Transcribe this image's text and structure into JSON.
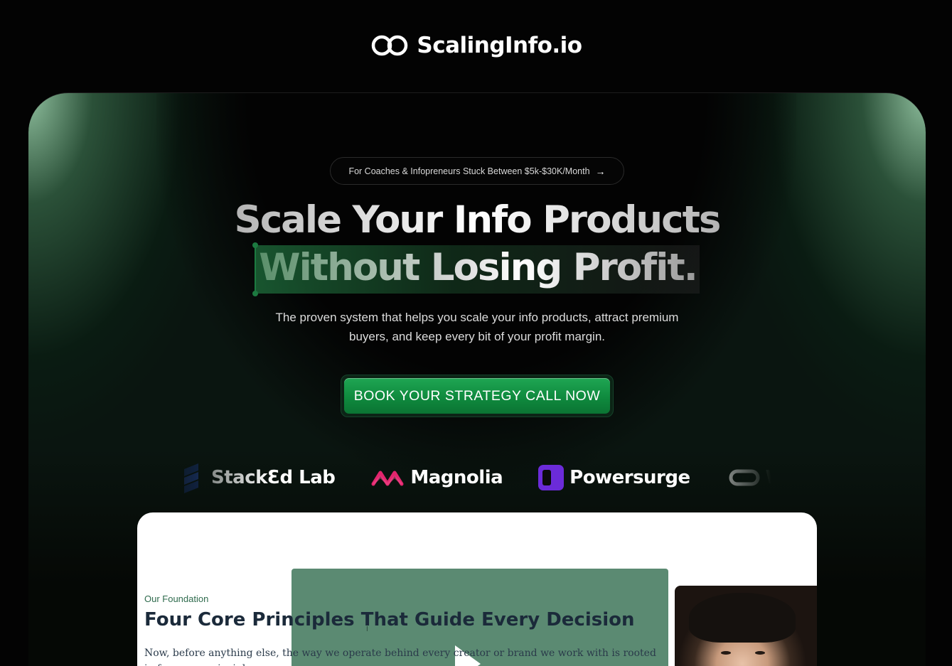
{
  "header": {
    "logo_text": "ScalingInfo.io",
    "logo_icon": "infinity-loop-icon"
  },
  "hero": {
    "badge_text": "For Coaches & Infopreneurs Stuck Between $5k-$30K/Month",
    "badge_arrow": "→",
    "headline_line1": "Scale Your Info Products",
    "headline_line2": "Without Losing Profit.",
    "subheadline": "The proven system that helps you scale your info products, attract premium buyers, and keep every bit of your profit margin.",
    "cta_label": "BOOK YOUR STRATEGY CALL NOW",
    "colors": {
      "accent": "#129a47",
      "background": "#030303",
      "glow": "#96c8a5"
    }
  },
  "brands": [
    {
      "name": "StackƐd Lab",
      "icon": "stacked-lab-icon"
    },
    {
      "name": "Magnolia",
      "icon": "magnolia-icon"
    },
    {
      "name": "Powersurge",
      "icon": "powersurge-icon"
    },
    {
      "name": "Warpspeed",
      "icon": "warpspeed-icon"
    }
  ],
  "foundation": {
    "eyebrow": "Our Foundation",
    "title": "Four Core Principles That Guide Every Decision",
    "body": "Now, before anything else, the way we operate behind every creator or brand we work with is rooted in four core principles.",
    "video_icon": "play-icon",
    "portrait_icon": "founder-portrait-image"
  }
}
